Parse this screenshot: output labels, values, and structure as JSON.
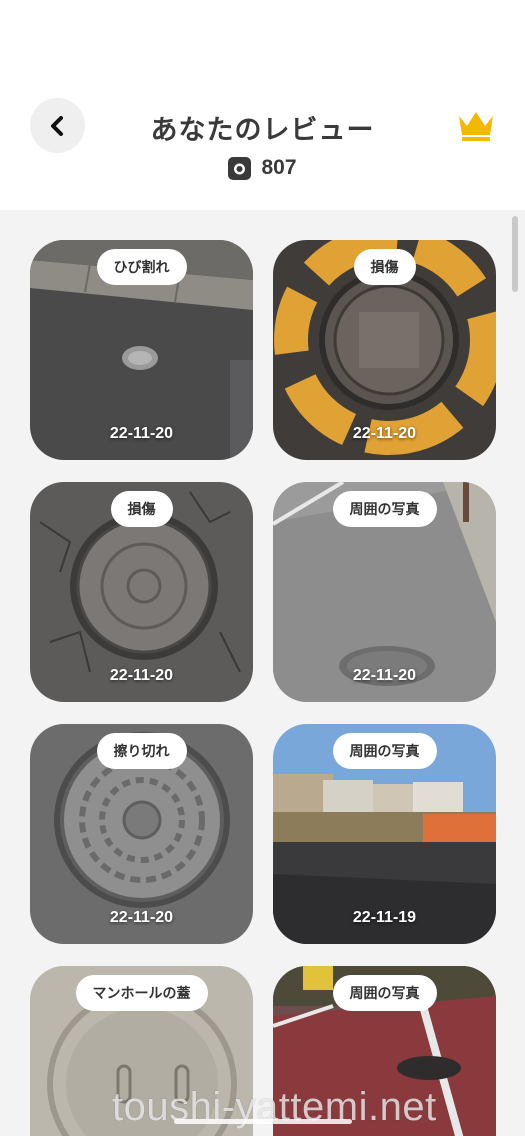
{
  "header": {
    "title": "あなたのレビュー",
    "review_count": "807",
    "back_icon": "chevron-left-icon",
    "crown_icon": "crown-icon",
    "crown_color": "#f5b800",
    "count_icon": "camera-icon"
  },
  "reviews": [
    {
      "tag": "ひび割れ",
      "date": "22-11-20"
    },
    {
      "tag": "損傷",
      "date": "22-11-20"
    },
    {
      "tag": "損傷",
      "date": "22-11-20"
    },
    {
      "tag": "周囲の写真",
      "date": "22-11-20"
    },
    {
      "tag": "擦り切れ",
      "date": "22-11-20"
    },
    {
      "tag": "周囲の写真",
      "date": "22-11-19"
    },
    {
      "tag": "マンホールの蓋",
      "date": ""
    },
    {
      "tag": "周囲の写真",
      "date": ""
    }
  ],
  "watermark": "toushi-yattemi.net"
}
